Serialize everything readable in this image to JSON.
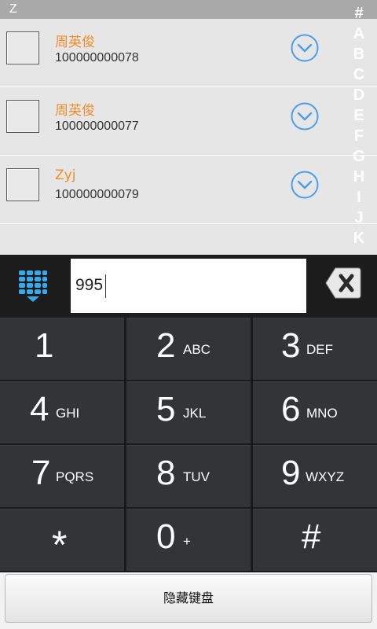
{
  "section": {
    "letter": "Z"
  },
  "contacts": [
    {
      "name": "周英俊",
      "number": "100000000078"
    },
    {
      "name": "周英俊",
      "number": "100000000077"
    },
    {
      "name": "Zyj",
      "number": "100000000079"
    }
  ],
  "index_bar": [
    "#",
    "A",
    "B",
    "C",
    "D",
    "E",
    "F",
    "G",
    "H",
    "I",
    "J",
    "K"
  ],
  "dialer": {
    "input_value": "995",
    "keys": [
      {
        "digit": "1",
        "letters": ""
      },
      {
        "digit": "2",
        "letters": "ABC"
      },
      {
        "digit": "3",
        "letters": "DEF"
      },
      {
        "digit": "4",
        "letters": "GHI"
      },
      {
        "digit": "5",
        "letters": "JKL"
      },
      {
        "digit": "6",
        "letters": "MNO"
      },
      {
        "digit": "7",
        "letters": "PQRS"
      },
      {
        "digit": "8",
        "letters": "TUV"
      },
      {
        "digit": "9",
        "letters": "WXYZ"
      },
      {
        "digit": "*",
        "letters": ""
      },
      {
        "digit": "0",
        "letters": "+"
      },
      {
        "digit": "#",
        "letters": ""
      }
    ]
  },
  "hide_keyboard_label": "隐藏键盘",
  "icons": {
    "dialpad": "dialpad-icon",
    "backspace": "backspace-icon",
    "expand": "chevron-down-circle-icon"
  },
  "colors": {
    "name_accent": "#f08c2a",
    "icon_blue": "#4a9ee8",
    "keypad_key": "#333436"
  }
}
